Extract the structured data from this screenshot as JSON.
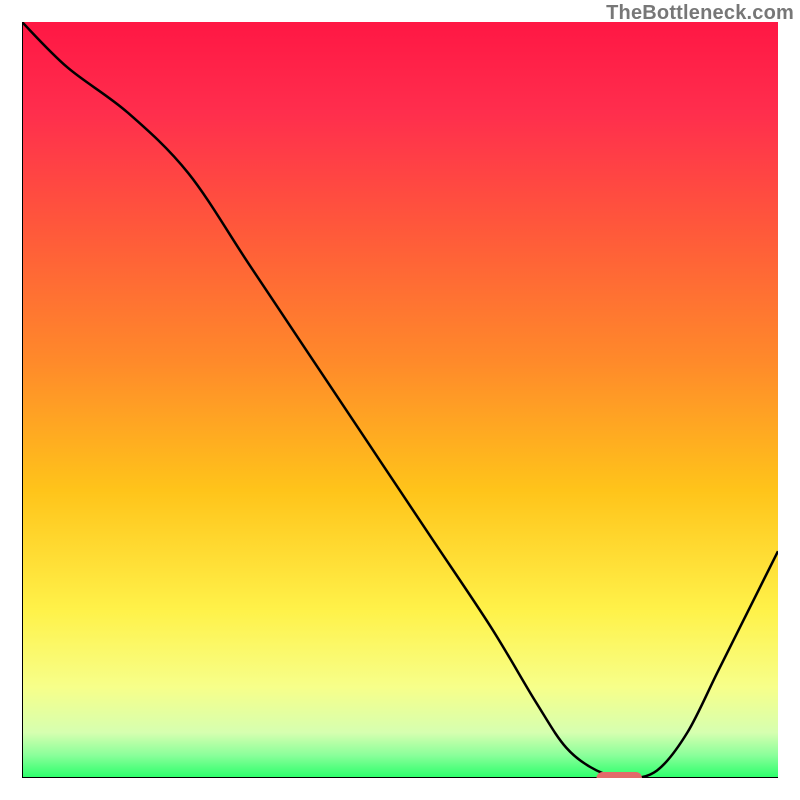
{
  "watermark": "TheBottleneck.com",
  "colors": {
    "gradient_stops": [
      {
        "offset": 0.0,
        "color": "#ff1744"
      },
      {
        "offset": 0.12,
        "color": "#ff2e4d"
      },
      {
        "offset": 0.28,
        "color": "#ff5a3a"
      },
      {
        "offset": 0.45,
        "color": "#ff8a2a"
      },
      {
        "offset": 0.62,
        "color": "#ffc41a"
      },
      {
        "offset": 0.78,
        "color": "#fff24a"
      },
      {
        "offset": 0.88,
        "color": "#f7ff8a"
      },
      {
        "offset": 0.94,
        "color": "#d6ffb0"
      },
      {
        "offset": 0.97,
        "color": "#8aff9a"
      },
      {
        "offset": 1.0,
        "color": "#2aff6a"
      }
    ],
    "axis": "#000000",
    "curve": "#000000",
    "marker": "#e26a6a"
  },
  "chart_data": {
    "type": "line",
    "title": "",
    "xlabel": "",
    "ylabel": "",
    "xlim": [
      0,
      100
    ],
    "ylim": [
      0,
      100
    ],
    "x": [
      0,
      6,
      14,
      22,
      30,
      38,
      46,
      54,
      62,
      68,
      72,
      76,
      80,
      84,
      88,
      92,
      96,
      100
    ],
    "values": [
      100,
      94,
      88,
      80,
      68,
      56,
      44,
      32,
      20,
      10,
      4,
      1,
      0,
      1,
      6,
      14,
      22,
      30
    ],
    "marker": {
      "x_start": 76,
      "x_end": 82,
      "y": 0
    }
  }
}
